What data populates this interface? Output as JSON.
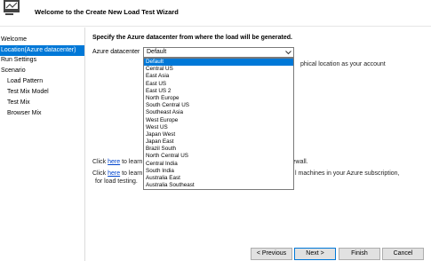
{
  "header": {
    "title": "Welcome to the Create New Load Test Wizard"
  },
  "sidebar": {
    "items": [
      {
        "label": "Welcome"
      },
      {
        "label": "Location(Azure datacenter)"
      },
      {
        "label": "Run Settings"
      },
      {
        "label": "Scenario"
      },
      {
        "label": "Load Pattern"
      },
      {
        "label": "Test Mix Model"
      },
      {
        "label": "Test Mix"
      },
      {
        "label": "Browser Mix"
      }
    ],
    "active_index": 1
  },
  "main": {
    "instruction": "Specify the Azure datacenter from where the load will be generated.",
    "datacenter_label": "Azure datacenter",
    "datacenter_value": "Default",
    "options": [
      "Default",
      "Central US",
      "East Asia",
      "East US",
      "East US 2",
      "North Europe",
      "South Central US",
      "Southeast Asia",
      "West Europe",
      "West US",
      "Japan West",
      "Japan East",
      "Brazil South",
      "North Central US",
      "Central India",
      "South India",
      "Australia East",
      "Australia Southeast"
    ],
    "hint": "phical location as your account",
    "firewall_prefix": "Click ",
    "firewall_link": "here",
    "firewall_mid": " to learn a",
    "firewall_tail": "e firewall.",
    "vm_prefix": "Click ",
    "vm_link": "here",
    "vm_mid": " to learn a",
    "vm_tail": "l machines in your Azure subscription,",
    "vm_line2": "for load testing."
  },
  "buttons": {
    "previous": "< Previous",
    "next": "Next >",
    "finish": "Finish",
    "cancel": "Cancel"
  }
}
